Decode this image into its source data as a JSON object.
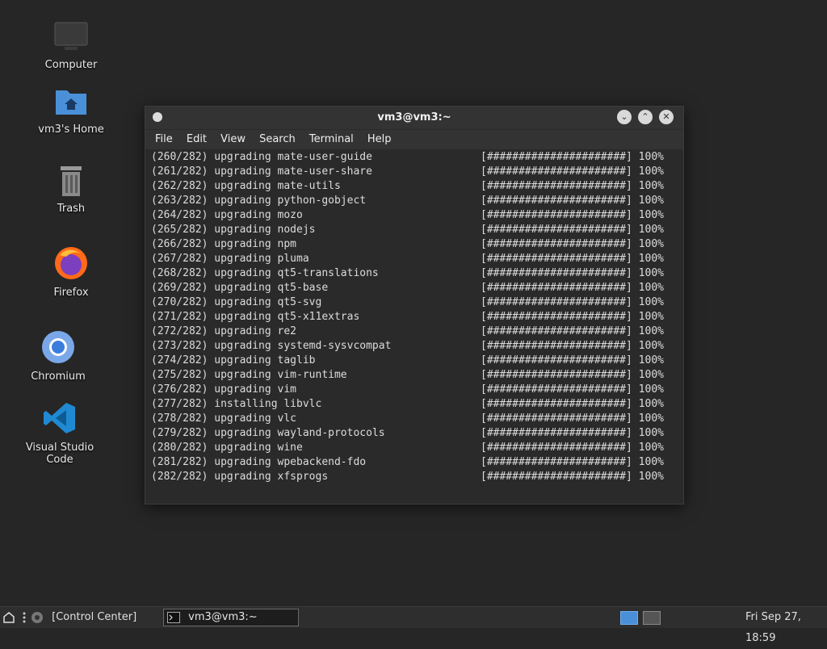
{
  "desktop": {
    "icons": [
      {
        "label": "Computer"
      },
      {
        "label": "vm3's Home"
      },
      {
        "label": "Trash"
      },
      {
        "label": "Firefox"
      },
      {
        "label": "Chromium"
      },
      {
        "label": "Visual Studio Code"
      }
    ]
  },
  "window": {
    "title": "vm3@vm3:~",
    "menu": [
      "File",
      "Edit",
      "View",
      "Search",
      "Terminal",
      "Help"
    ]
  },
  "terminal": {
    "lines": [
      {
        "text": "(260/282) upgrading mate-user-guide",
        "bar": "[######################] 100%"
      },
      {
        "text": "(261/282) upgrading mate-user-share",
        "bar": "[######################] 100%"
      },
      {
        "text": "(262/282) upgrading mate-utils",
        "bar": "[######################] 100%"
      },
      {
        "text": "(263/282) upgrading python-gobject",
        "bar": "[######################] 100%"
      },
      {
        "text": "(264/282) upgrading mozo",
        "bar": "[######################] 100%"
      },
      {
        "text": "(265/282) upgrading nodejs",
        "bar": "[######################] 100%"
      },
      {
        "text": "(266/282) upgrading npm",
        "bar": "[######################] 100%"
      },
      {
        "text": "(267/282) upgrading pluma",
        "bar": "[######################] 100%"
      },
      {
        "text": "(268/282) upgrading qt5-translations",
        "bar": "[######################] 100%"
      },
      {
        "text": "(269/282) upgrading qt5-base",
        "bar": "[######################] 100%"
      },
      {
        "text": "(270/282) upgrading qt5-svg",
        "bar": "[######################] 100%"
      },
      {
        "text": "(271/282) upgrading qt5-x11extras",
        "bar": "[######################] 100%"
      },
      {
        "text": "(272/282) upgrading re2",
        "bar": "[######################] 100%"
      },
      {
        "text": "(273/282) upgrading systemd-sysvcompat",
        "bar": "[######################] 100%"
      },
      {
        "text": "(274/282) upgrading taglib",
        "bar": "[######################] 100%"
      },
      {
        "text": "(275/282) upgrading vim-runtime",
        "bar": "[######################] 100%"
      },
      {
        "text": "(276/282) upgrading vim",
        "bar": "[######################] 100%"
      },
      {
        "text": "(277/282) installing libvlc",
        "bar": "[######################] 100%"
      },
      {
        "text": "(278/282) upgrading vlc",
        "bar": "[######################] 100%"
      },
      {
        "text": "(279/282) upgrading wayland-protocols",
        "bar": "[######################] 100%"
      },
      {
        "text": "(280/282) upgrading wine",
        "bar": "[######################] 100%"
      },
      {
        "text": "(281/282) upgrading wpebackend-fdo",
        "bar": "[######################] 100%"
      },
      {
        "text": "(282/282) upgrading xfsprogs",
        "bar": "[######################] 100%"
      }
    ]
  },
  "taskbar": {
    "control_center": "[Control Center]",
    "task": "vm3@vm3:~",
    "clock": "Fri Sep 27, 18:59"
  },
  "colors": {
    "desktop_bg": "#262626",
    "terminal_bg": "#2a2a2a",
    "folder_blue": "#4a90d9",
    "vscode_blue": "#1f8ad2",
    "workspace_active": "#4a90d9"
  }
}
